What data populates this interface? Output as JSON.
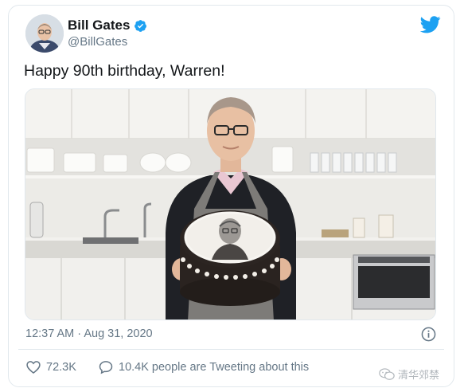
{
  "tweet": {
    "display_name": "Bill Gates",
    "handle": "@BillGates",
    "text": "Happy 90th birthday, Warren!",
    "timestamp": "12:37 AM · Aug 31, 2020"
  },
  "actions": {
    "like_count": "72.3K",
    "reply_text": "10.4K people are Tweeting about this"
  },
  "watermark": {
    "text": "清华郊禁"
  },
  "icons": {
    "verified": "verified-badge-icon",
    "bird": "twitter-bird-icon",
    "info": "info-icon",
    "heart": "heart-icon",
    "reply": "speech-bubble-icon"
  },
  "colors": {
    "twitter_blue": "#1da1f2",
    "secondary_text": "#657786",
    "border": "#e1e8ed"
  }
}
